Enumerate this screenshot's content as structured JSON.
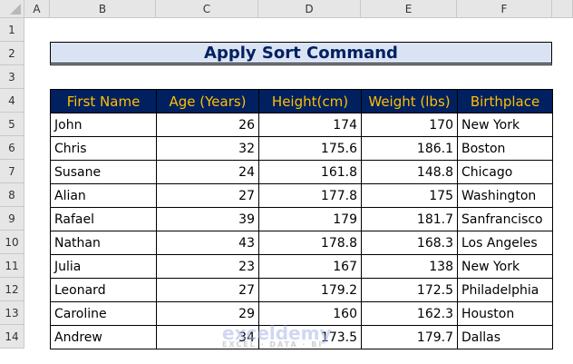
{
  "sheet": {
    "columns": [
      "A",
      "B",
      "C",
      "D",
      "E",
      "F"
    ],
    "rows": [
      "1",
      "2",
      "3",
      "4",
      "5",
      "6",
      "7",
      "8",
      "9",
      "10",
      "11",
      "12",
      "13",
      "14"
    ]
  },
  "title": "Apply Sort Command",
  "table": {
    "headers": [
      "First Name",
      "Age (Years)",
      "Height(cm)",
      "Weight (lbs)",
      "Birthplace"
    ],
    "rows": [
      [
        "John",
        "26",
        "174",
        "170",
        "New York"
      ],
      [
        "Chris",
        "32",
        "175.6",
        "186.1",
        "Boston"
      ],
      [
        "Susane",
        "24",
        "161.8",
        "148.8",
        "Chicago"
      ],
      [
        "Alian",
        "27",
        "177.8",
        "175",
        "Washington"
      ],
      [
        "Rafael",
        "39",
        "179",
        "181.7",
        "Sanfrancisco"
      ],
      [
        "Nathan",
        "43",
        "178.8",
        "168.3",
        "Los Angeles"
      ],
      [
        "Julia",
        "23",
        "167",
        "138",
        "New York"
      ],
      [
        "Leonard",
        "27",
        "179.2",
        "172.5",
        "Philadelphia"
      ],
      [
        "Caroline",
        "29",
        "160",
        "162.3",
        "Houston"
      ],
      [
        "Andrew",
        "34",
        "173.5",
        "179.7",
        "Dallas"
      ]
    ]
  },
  "watermark": {
    "name": "exceldemy",
    "tagline": "EXCEL · DATA · BI"
  },
  "colors": {
    "header_bg": "#002060",
    "header_text": "#ffc000",
    "title_bg": "#dae3f3"
  }
}
